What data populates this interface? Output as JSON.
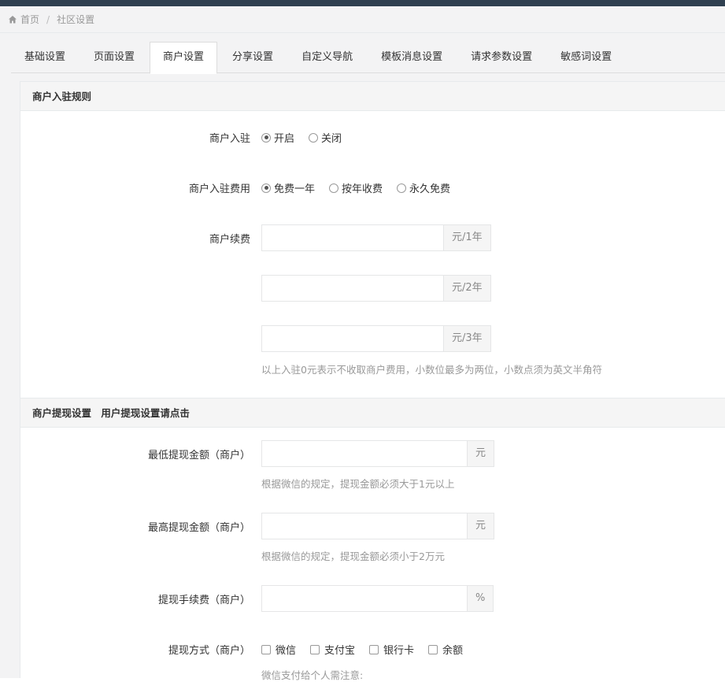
{
  "breadcrumb": {
    "home": "首页",
    "current": "社区设置"
  },
  "tabs": [
    "基础设置",
    "页面设置",
    "商户设置",
    "分享设置",
    "自定义导航",
    "模板消息设置",
    "请求参数设置",
    "敏感词设置"
  ],
  "active_tab": "商户设置",
  "section1": {
    "title": "商户入驻规则",
    "join": {
      "label": "商户入驻",
      "options": [
        "开启",
        "关闭"
      ],
      "selected": "开启"
    },
    "fee": {
      "label": "商户入驻费用",
      "options": [
        "免费一年",
        "按年收费",
        "永久免费"
      ],
      "selected": "免费一年"
    },
    "renew": {
      "label": "商户续费",
      "units": [
        "元/1年",
        "元/2年",
        "元/3年"
      ],
      "values": [
        "",
        "",
        ""
      ],
      "help": "以上入驻0元表示不收取商户费用，小数位最多为两位，小数点须为英文半角符"
    }
  },
  "section2": {
    "title": "商户提现设置",
    "title_link": "用户提现设置请点击",
    "min": {
      "label": "最低提现金额（商户）",
      "unit": "元",
      "value": "",
      "help": "根据微信的规定，提现金额必须大于1元以上"
    },
    "max": {
      "label": "最高提现金额（商户）",
      "unit": "元",
      "value": "",
      "help": "根据微信的规定，提现金额必须小于2万元"
    },
    "fee": {
      "label": "提现手续费（商户）",
      "unit": "%",
      "value": ""
    },
    "method": {
      "label": "提现方式（商户）",
      "options": [
        "微信",
        "支付宝",
        "银行卡",
        "余额"
      ],
      "help": "微信支付给个人需注意:"
    }
  },
  "colors": {
    "topbar": "#2f4050",
    "background": "#f3f3f4",
    "border": "#e5e6e7"
  }
}
